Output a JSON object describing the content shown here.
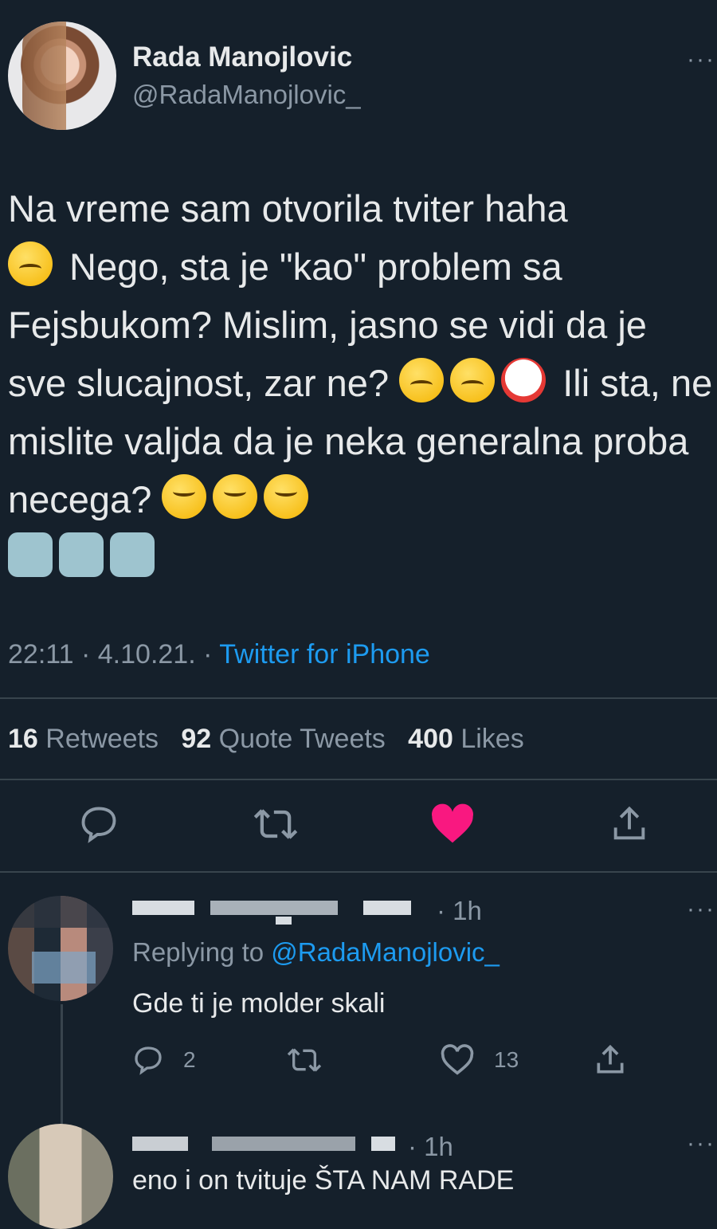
{
  "tweet": {
    "name": "Rada Manojlovic",
    "handle": "@RadaManojlovic_",
    "text_parts": [
      "Na vreme sam otvorila tviter haha ",
      " Nego, sta je \"kao\" problem sa Fejsbukom? Mislim, jasno se vidi da je sve slucajnost, zar ne? ",
      " Ili sta, ne mislite valjda da je neka generalna proba necega? "
    ],
    "emojis": {
      "first": "grimacing-face-emoji",
      "laugh": "rolling-on-floor-laughing-emoji",
      "woozy": "woozy-face-emoji",
      "clown": "clown-face-emoji",
      "upside": "upside-down-face-emoji",
      "robot": "robot-face-emoji"
    },
    "time": "22:11 · 4.10.21. · ",
    "source": "Twitter for iPhone",
    "more": "···"
  },
  "stats": {
    "retweets_count": "16",
    "retweets_label": "Retweets",
    "quotes_count": "92",
    "quotes_label": "Quote Tweets",
    "likes_count": "400",
    "likes_label": "Likes"
  },
  "colors": {
    "background": "#15202b",
    "link": "#1d9bf0",
    "like": "#f91880",
    "muted": "#8b98a5"
  },
  "replies": [
    {
      "time": "· 1h",
      "replying_prefix": "Replying to ",
      "replying_to": "@RadaManojlovic_",
      "text": "Gde ti je molder skali",
      "reply_count": "2",
      "like_count": "13",
      "more": "···"
    },
    {
      "time": "· 1h",
      "text": "eno i on tvituje ŠTA NAM RADE",
      "more": "···"
    }
  ]
}
